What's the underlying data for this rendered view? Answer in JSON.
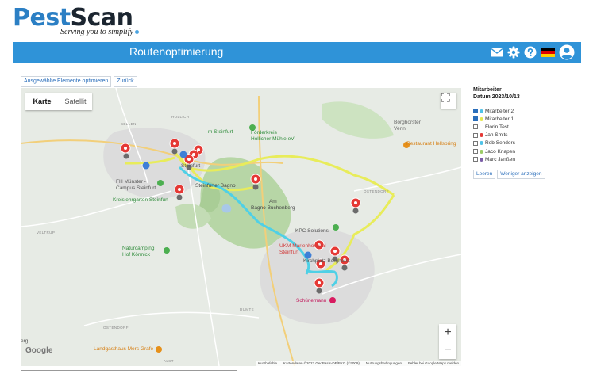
{
  "logo": {
    "pest": "Pest",
    "scan": "Scan",
    "tagline": "Serving you to simplify"
  },
  "header": {
    "title": "Routenoptimierung",
    "icons": [
      "mail-icon",
      "gear-icon",
      "help-icon",
      "german-flag-icon",
      "user-icon"
    ]
  },
  "toolbar": {
    "optimize_label": "Ausgewählte Elemente optimieren",
    "back_label": "Zurück"
  },
  "map": {
    "type_map": "Karte",
    "type_satellite": "Satellit",
    "zoom_in": "+",
    "zoom_out": "−",
    "google": "Google",
    "attribution": {
      "shortcuts": "Kurzbefehle",
      "data": "Kartendaten ©2023 GeoBasis-DE/BKG (©2009)",
      "terms": "Nutzungsbedingungen",
      "report": "Fehler bei Google Maps melden"
    },
    "labels": {
      "sellen": "SELLEN",
      "hollich": "HOLLICH",
      "steinfurt": "Steinfurt",
      "fh_campus": "FH Münster -\nCampus Steinfurt",
      "kreislehrgarten": "Kreislehrgarten Steinfurt",
      "steinfurter_bagno": "Steinfurter Bagno",
      "am_bagno": "Am\nBagno Buchenberg",
      "foerderkreis": "Förderkreis\nHollicher Mühle eV",
      "borghorster": "Borghorster\nVenn",
      "restaurant": "Restaurant Hellspring",
      "ostendorf": "OSTENDORF",
      "kpc": "KPC Solutions",
      "ukm": "UKM Marienhospital\nSteinfurt",
      "kirchplatz": "Kirchplatz Borghorst",
      "schuenemann": "Schünemann",
      "veltrup": "VELTRUP",
      "naturcamping": "Naturcamping\nHof Könnick",
      "dumte": "DUMTE",
      "ostendorf2": "OSTENDORF",
      "landgasthaus": "Landgasthaus Mers Grafe",
      "erg": "erg",
      "alst": "ALST",
      "steinfurt_short": "m Steinfurt"
    }
  },
  "panel": {
    "title": "Mitarbeiter",
    "date_line": "Datum 2023/10/13",
    "employees": [
      {
        "name": "Mitarbeiter 2",
        "checked": true,
        "color": "#4fc3e8"
      },
      {
        "name": "Mitarbeiter 1",
        "checked": true,
        "color": "#e6e84f"
      },
      {
        "name": "Florin Test",
        "checked": false,
        "color": ""
      },
      {
        "name": "Jan Smits",
        "checked": false,
        "color": "#e53935"
      },
      {
        "name": "Rob Senders",
        "checked": false,
        "color": "#4fc3e8"
      },
      {
        "name": "Jaco Knapen",
        "checked": false,
        "color": "#9ccc65"
      },
      {
        "name": "Marc Janßen",
        "checked": false,
        "color": "#7b5ea7"
      }
    ],
    "clear_label": "Leeren",
    "less_label": "Weniger anzeigen"
  },
  "colors": {
    "header_bar": "#2f93d8",
    "route_cyan": "#4fd0e6",
    "route_yellow": "#e8ec5a",
    "marker_red": "#e53935",
    "forest": "#b9d7a9"
  }
}
